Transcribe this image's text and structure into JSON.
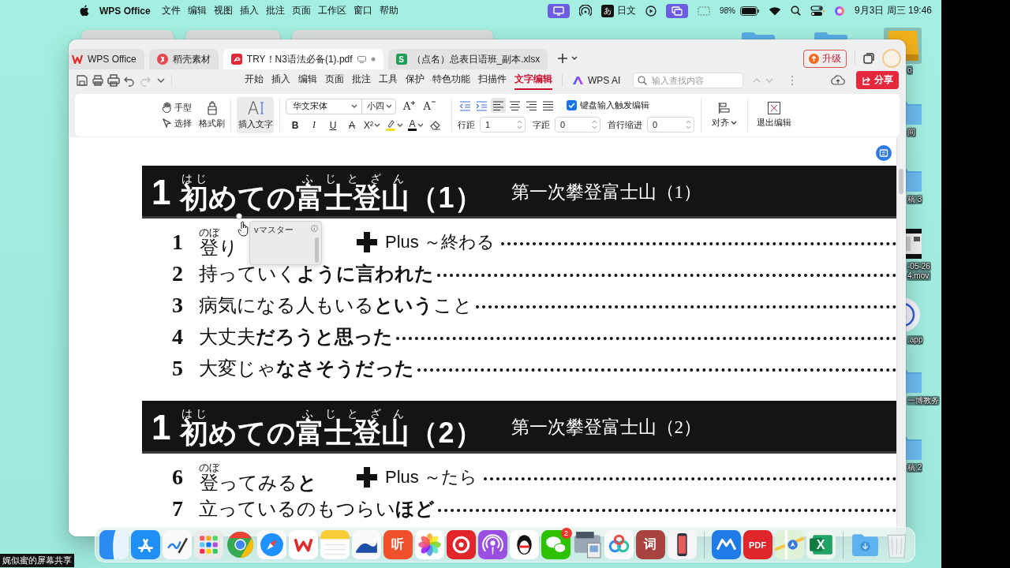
{
  "menubar": {
    "app_name": "WPS Office",
    "menus": [
      "文件",
      "编辑",
      "视图",
      "插入",
      "批注",
      "页面",
      "工作区",
      "窗口",
      "帮助"
    ],
    "input_badge": "あ",
    "input_label": "日文",
    "battery": "98%",
    "clock": "9月3日 周三 19:46"
  },
  "desktop": {
    "icons": [
      {
        "kind": "drive",
        "label_lines": [
          "o"
        ]
      },
      {
        "kind": "folder",
        "label_lines": [
          "间"
        ]
      },
      {
        "kind": "folder",
        "label_lines": [
          "稿 3"
        ]
      },
      {
        "kind": "video",
        "label_lines": [
          "-05-26",
          "4.mov"
        ]
      },
      {
        "kind": "app",
        "label_lines": [
          ".app"
        ]
      },
      {
        "kind": "folder",
        "label_lines": [
          "一博教务"
        ]
      },
      {
        "kind": "folder",
        "label_lines": [
          "稿 2"
        ]
      }
    ]
  },
  "window": {
    "tabs": [
      {
        "kind": "home",
        "label": "WPS Office",
        "selected": false
      },
      {
        "kind": "docer",
        "label": "稻壳素材",
        "selected": false
      },
      {
        "kind": "pdf",
        "label": "TRY！N3语法必备(1).pdf",
        "selected": true
      },
      {
        "kind": "sheet",
        "glyph": "S",
        "label": "（点名）总表日语班_副本.xlsx",
        "selected": false
      }
    ],
    "upgrade_label": "升级",
    "ribbon_tabs": [
      {
        "label": "开始",
        "selected": false
      },
      {
        "label": "插入",
        "selected": false
      },
      {
        "label": "编辑",
        "selected": false
      },
      {
        "label": "页面",
        "selected": false
      },
      {
        "label": "批注",
        "selected": false
      },
      {
        "label": "工具",
        "selected": false
      },
      {
        "label": "保护",
        "selected": false
      },
      {
        "label": "特色功能",
        "selected": false
      },
      {
        "label": "扫描件",
        "selected": false
      },
      {
        "label": "文字编辑",
        "selected": true
      }
    ],
    "ai_label": "WPS AI",
    "search_placeholder": "输入查找内容",
    "share_label": "分享",
    "ribbon": {
      "hand_tool": "手型",
      "select_tool": "选择",
      "format_painter": "格式刷",
      "insert_text": {
        "label": "插入文字",
        "selected": true
      },
      "font_name": "华文宋体",
      "font_size": "小四",
      "size_buttons": [
        {
          "kind": "grow",
          "glyph": "A"
        },
        {
          "kind": "shrink",
          "glyph": "A"
        }
      ],
      "format_buttons": [
        {
          "kind": "bold",
          "glyph": "B"
        },
        {
          "kind": "italic",
          "glyph": "I"
        },
        {
          "kind": "underline",
          "glyph": "U"
        },
        {
          "kind": "strikethrough",
          "glyph": "A"
        },
        {
          "kind": "superscript",
          "glyph": "X²"
        },
        {
          "kind": "highlight"
        },
        {
          "kind": "font_color",
          "glyph": "A"
        },
        {
          "kind": "eraser"
        }
      ],
      "align_buttons": [
        {
          "kind": "outdent",
          "selected": false
        },
        {
          "kind": "indent",
          "selected": false
        },
        {
          "kind": "left",
          "selected": true
        },
        {
          "kind": "center",
          "selected": false
        },
        {
          "kind": "right",
          "selected": false
        },
        {
          "kind": "justify",
          "selected": false
        }
      ],
      "keyboard_edit": {
        "label": "键盘输入触发编辑",
        "checked": true
      },
      "spacing_fields": [
        {
          "label": "行距",
          "value": "1"
        },
        {
          "label": "字距",
          "value": "0"
        },
        {
          "label": "首行缩进",
          "value": "0"
        }
      ],
      "align_label": "对齐",
      "exit_label": "退出编辑"
    }
  },
  "document": {
    "sections": [
      {
        "number": "1",
        "title": [
          {
            "text": "初",
            "ruby": "はじ"
          },
          {
            "text": "めての"
          },
          {
            "text": "富士登山",
            "ruby": "ふじとざん"
          },
          {
            "text": "（1）"
          }
        ],
        "subtitle": "第一次攀登富士山（1）",
        "items": [
          {
            "number": "1",
            "segments": [
              {
                "text": "登",
                "ruby": "のぼ",
                "bold": false
              },
              {
                "text": "り",
                "bold": false
              }
            ],
            "plus": "Plus ～終わる"
          },
          {
            "number": "2",
            "segments": [
              {
                "text": "持っていく",
                "bold": false
              },
              {
                "text": "ように言われた",
                "bold": true
              }
            ]
          },
          {
            "number": "3",
            "segments": [
              {
                "text": "病気になる人もいる",
                "bold": false
              },
              {
                "text": "という",
                "bold": true
              },
              {
                "text": "こと",
                "bold": false
              }
            ]
          },
          {
            "number": "4",
            "segments": [
              {
                "text": "大丈夫",
                "bold": false
              },
              {
                "text": "だろうと思った",
                "bold": true
              }
            ]
          },
          {
            "number": "5",
            "segments": [
              {
                "text": "大変じゃ",
                "bold": false
              },
              {
                "text": "なさそうだった",
                "bold": true
              }
            ]
          }
        ]
      },
      {
        "number": "1",
        "title": [
          {
            "text": "初",
            "ruby": "はじ"
          },
          {
            "text": "めての"
          },
          {
            "text": "富士登山",
            "ruby": "ふじとざん"
          },
          {
            "text": "（2）"
          }
        ],
        "subtitle": "第一次攀登富士山（2）",
        "items": [
          {
            "number": "6",
            "segments": [
              {
                "text": "登",
                "ruby": "のぼ",
                "bold": false
              },
              {
                "text": "ってみる",
                "bold": false
              },
              {
                "text": "と",
                "bold": true
              }
            ],
            "plus": "Plus ～たら"
          },
          {
            "number": "7",
            "segments": [
              {
                "text": "立っているのもつらい",
                "bold": false
              },
              {
                "text": "ほど",
                "bold": true
              }
            ]
          }
        ]
      }
    ],
    "popup": {
      "title": "vマスター"
    }
  },
  "dock": {
    "apps": [
      {
        "kind": "finder"
      },
      {
        "kind": "appstore"
      },
      {
        "kind": "freeform"
      },
      {
        "kind": "launchpad"
      },
      {
        "kind": "chrome"
      },
      {
        "kind": "safari"
      },
      {
        "kind": "wps"
      },
      {
        "kind": "notes"
      },
      {
        "kind": "wave"
      },
      {
        "kind": "ximalaya",
        "glyph": "听"
      },
      {
        "kind": "photos"
      },
      {
        "kind": "netease"
      },
      {
        "kind": "podcasts"
      },
      {
        "kind": "qq"
      },
      {
        "kind": "wechat",
        "badge": "2"
      },
      {
        "kind": "preview"
      },
      {
        "kind": "loops"
      },
      {
        "kind": "dict",
        "glyph": "词"
      },
      {
        "kind": "phone"
      }
    ],
    "documents": [
      {
        "kind": "meeting"
      },
      {
        "kind": "pdf",
        "glyph": "PDF"
      },
      {
        "kind": "maps"
      },
      {
        "kind": "excel",
        "glyph": "X"
      }
    ],
    "stacks": [
      {
        "kind": "downloads"
      },
      {
        "kind": "trash"
      }
    ]
  },
  "share_caption": "娓似蜜的屏幕共享"
}
